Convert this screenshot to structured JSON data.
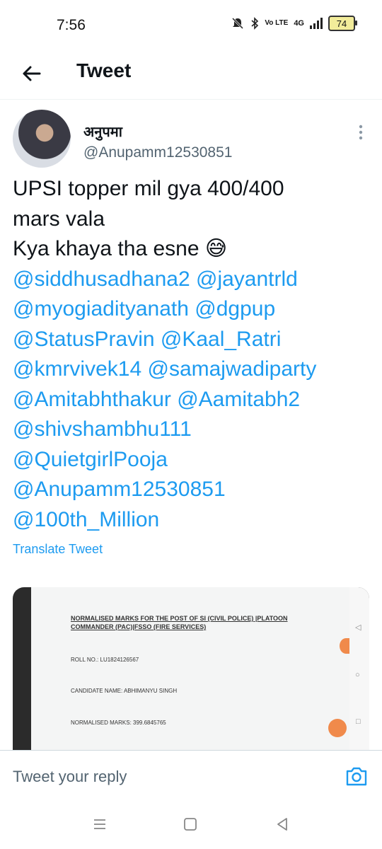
{
  "status_bar": {
    "time": "7:56",
    "network": "4G",
    "volte_label": "Vo LTE",
    "battery": "74"
  },
  "header": {
    "title": "Tweet"
  },
  "tweet": {
    "display_name": "अनुपमा",
    "handle": "@Anupamm12530851",
    "text_lines": [
      "UPSI topper mil gya 400/400",
      "mars vala",
      "Kya khaya tha esne 😅"
    ],
    "mention_lines": [
      "@siddhusadhana2 @jayantrld",
      "@myogiadityanath @dgpup",
      "@StatusPravin @Kaal_Ratri",
      "@kmrvivek14 @samajwadiparty",
      "@Amitabhthakur @Aamitabh2",
      "@shivshambhu111",
      "@QuietgirlPooja",
      "@Anupamm12530851",
      "@100th_Million"
    ],
    "translate_label": "Translate Tweet"
  },
  "media": {
    "heading": "NORMALISED MARKS FOR THE POST OF SI (CIVIL POLICE) |PLATOON COMMANDER (PAC)|FSSO (FIRE SERVICES)",
    "roll_no": "ROLL NO.:  LU1824126567",
    "candidate_name": "CANDIDATE NAME:  ABHIMANYU SINGH",
    "normalised_marks": "NORMALISED MARKS:  399.6845765"
  },
  "reply": {
    "placeholder": "Tweet your reply"
  },
  "colors": {
    "accent": "#1d9bf0",
    "text": "#0f1419",
    "muted": "#536471"
  }
}
